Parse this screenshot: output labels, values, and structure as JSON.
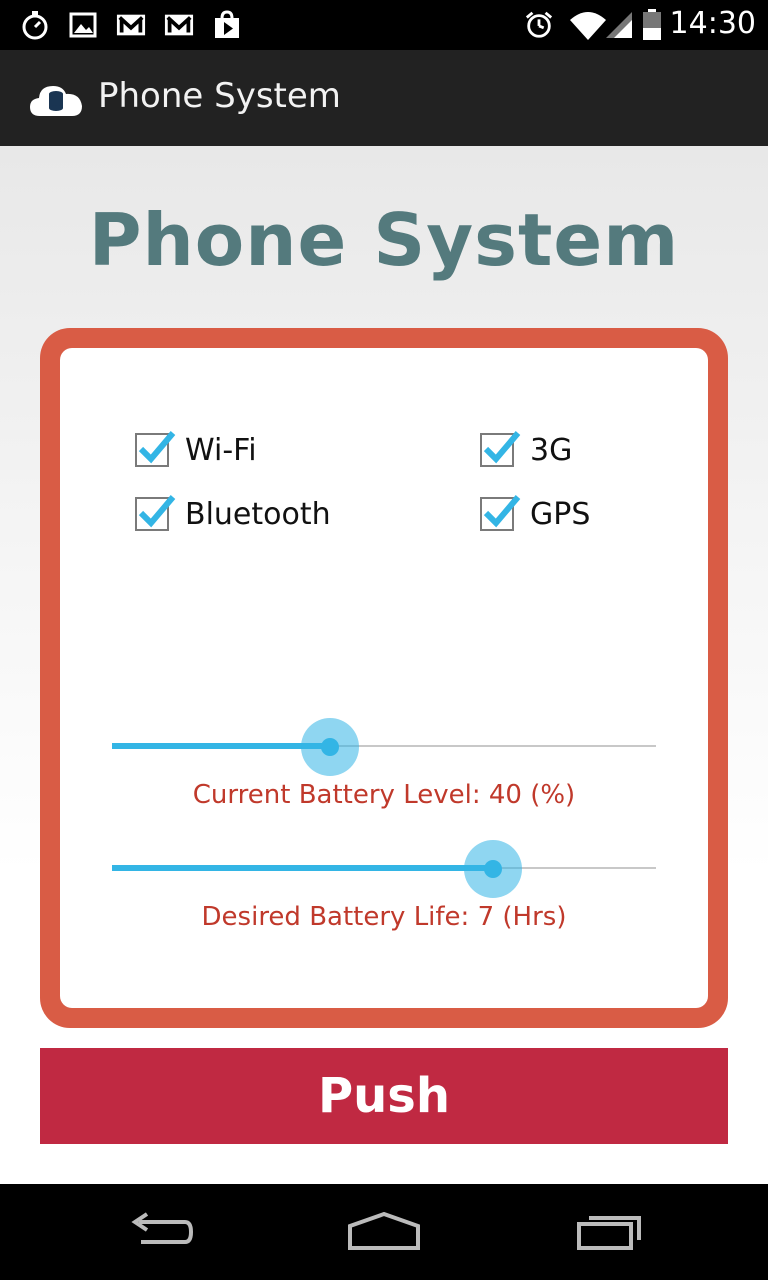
{
  "status_bar": {
    "time": "14:30",
    "left_icons": [
      "stopwatch-icon",
      "image-icon",
      "gmail-icon",
      "gmail-icon",
      "play-store-icon"
    ],
    "right_icons": [
      "alarm-icon",
      "wifi-icon",
      "signal-icon",
      "battery-icon"
    ]
  },
  "action_bar": {
    "title": "Phone System",
    "icon": "cloud-database-icon"
  },
  "main": {
    "title": "Phone System",
    "checkboxes": [
      {
        "label": "Wi-Fi",
        "checked": true
      },
      {
        "label": "3G",
        "checked": true
      },
      {
        "label": "Bluetooth",
        "checked": true
      },
      {
        "label": "GPS",
        "checked": true
      }
    ],
    "sliders": [
      {
        "label": "Current Battery Level: 40 (%)",
        "fraction": 0.4
      },
      {
        "label": "Desired Battery Life: 7 (Hrs)",
        "fraction": 0.7
      }
    ],
    "push_label": "Push"
  },
  "nav_bar": {
    "icons": [
      "back-icon",
      "home-icon",
      "recents-icon"
    ]
  },
  "colors": {
    "title": "#547a7d",
    "panel_border": "#d95c45",
    "slider_accent": "#33b5e5",
    "slider_label": "#c0392b",
    "push_button": "#c02942"
  }
}
